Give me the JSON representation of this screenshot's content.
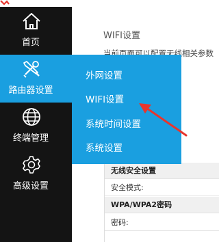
{
  "sidebar": {
    "items": [
      {
        "label": "首页",
        "icon": "home-icon"
      },
      {
        "label": "路由器设置",
        "icon": "wrench-screwdriver-icon"
      },
      {
        "label": "终端管理",
        "icon": "globe-icon"
      },
      {
        "label": "高级设置",
        "icon": "gear-icon"
      }
    ],
    "active_index": 1
  },
  "dropdown": {
    "items": [
      "外网设置",
      "WIFI设置",
      "系统时间设置",
      "系统设置"
    ]
  },
  "main": {
    "title": "WIFI设置",
    "description": "当前页面可以配置无线相关参数",
    "panel_rows": [
      {
        "type": "head",
        "label": "无线安全设置"
      },
      {
        "type": "field",
        "label": "安全模式:"
      },
      {
        "type": "head",
        "label": "WPA/WPA2密码"
      },
      {
        "type": "field",
        "label": "密码:"
      }
    ]
  },
  "colors": {
    "sidebar_bg": "#141414",
    "accent": "#1a9fe0",
    "arrow": "#e8352d"
  }
}
